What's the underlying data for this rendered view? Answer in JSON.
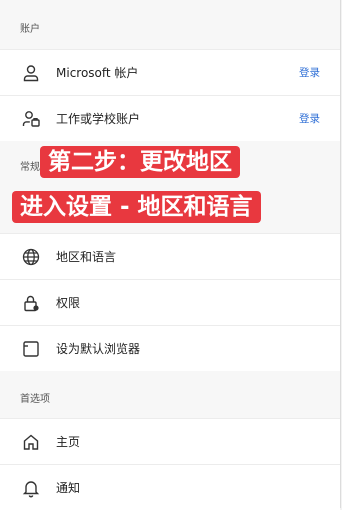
{
  "sections": {
    "account": {
      "header": "账户",
      "microsoft": {
        "label": "Microsoft 帐户",
        "action": "登录"
      },
      "work_school": {
        "label": "工作或学校账户",
        "action": "登录"
      }
    },
    "general": {
      "header_partial": "常规",
      "region": {
        "label": "地区和语言"
      },
      "permissions": {
        "label": "权限"
      },
      "default_browser": {
        "label": "设为默认浏览器"
      }
    },
    "preferences": {
      "header": "首选项",
      "home": {
        "label": "主页"
      },
      "notifications": {
        "label": "通知"
      }
    }
  },
  "overlay": {
    "line1": "第二步：更改地区",
    "line2": "进入设置 - 地区和语言",
    "color": "#e8383f"
  },
  "icons": {
    "microsoft": "person-icon",
    "work_school": "work-account-icon",
    "region": "globe-icon",
    "permissions": "lock-icon",
    "default_browser": "window-icon",
    "home": "home-icon",
    "notifications": "bell-icon"
  },
  "accent_color": "#2f6fd6"
}
